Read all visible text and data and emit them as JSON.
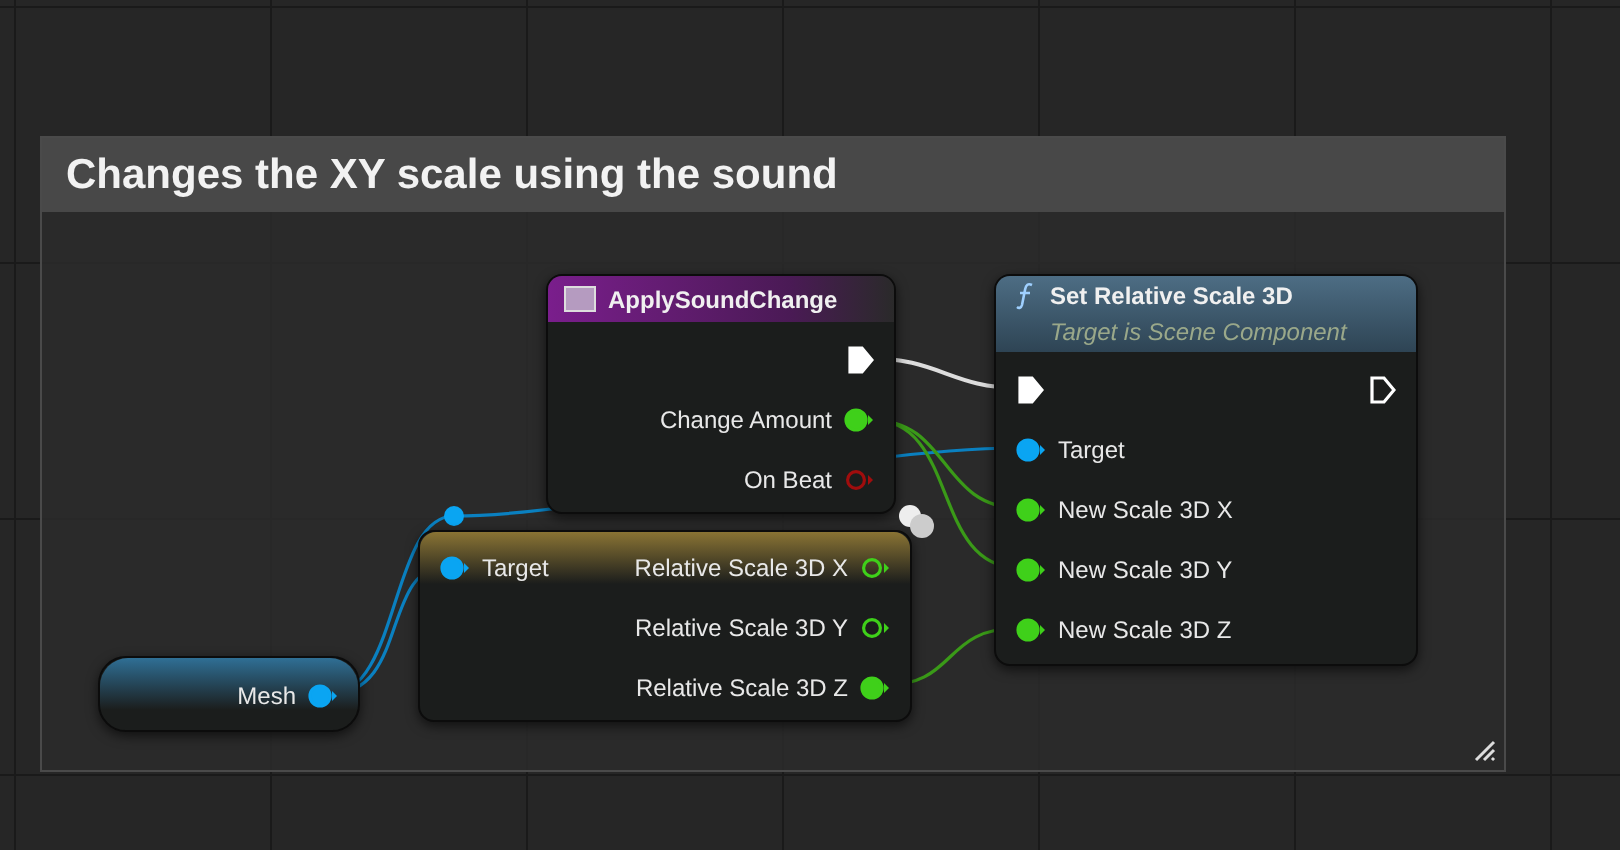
{
  "comment": {
    "title": "Changes the XY scale using the sound"
  },
  "nodes": [
    {
      "kind": "event",
      "title": "ApplySoundChange",
      "outputs": [
        {
          "kind": "exec",
          "connected": true
        },
        {
          "kind": "float",
          "label": "Change Amount",
          "connected": true
        },
        {
          "kind": "bool",
          "label": "On Beat",
          "connected": false
        }
      ]
    },
    {
      "kind": "function",
      "title": "Set Relative Scale 3D",
      "subtitle": "Target is Scene Component",
      "inputs": [
        {
          "kind": "exec",
          "connected": true
        },
        {
          "kind": "object",
          "label": "Target",
          "connected": true
        },
        {
          "kind": "float",
          "label": "New Scale 3D X",
          "connected": true
        },
        {
          "kind": "float",
          "label": "New Scale 3D Y",
          "connected": true
        },
        {
          "kind": "float",
          "label": "New Scale 3D Z",
          "connected": true
        }
      ],
      "outputs": [
        {
          "kind": "exec",
          "connected": false
        }
      ]
    },
    {
      "kind": "variable",
      "outputs": [
        {
          "kind": "object",
          "label": "Mesh",
          "connected": true
        }
      ]
    },
    {
      "kind": "getter",
      "inputs": [
        {
          "kind": "object",
          "label": "Target",
          "connected": true
        }
      ],
      "outputs": [
        {
          "kind": "float",
          "label": "Relative Scale 3D X",
          "connected": false
        },
        {
          "kind": "float",
          "label": "Relative Scale 3D Y",
          "connected": false
        },
        {
          "kind": "float",
          "label": "Relative Scale 3D Z",
          "connected": true
        }
      ]
    }
  ]
}
